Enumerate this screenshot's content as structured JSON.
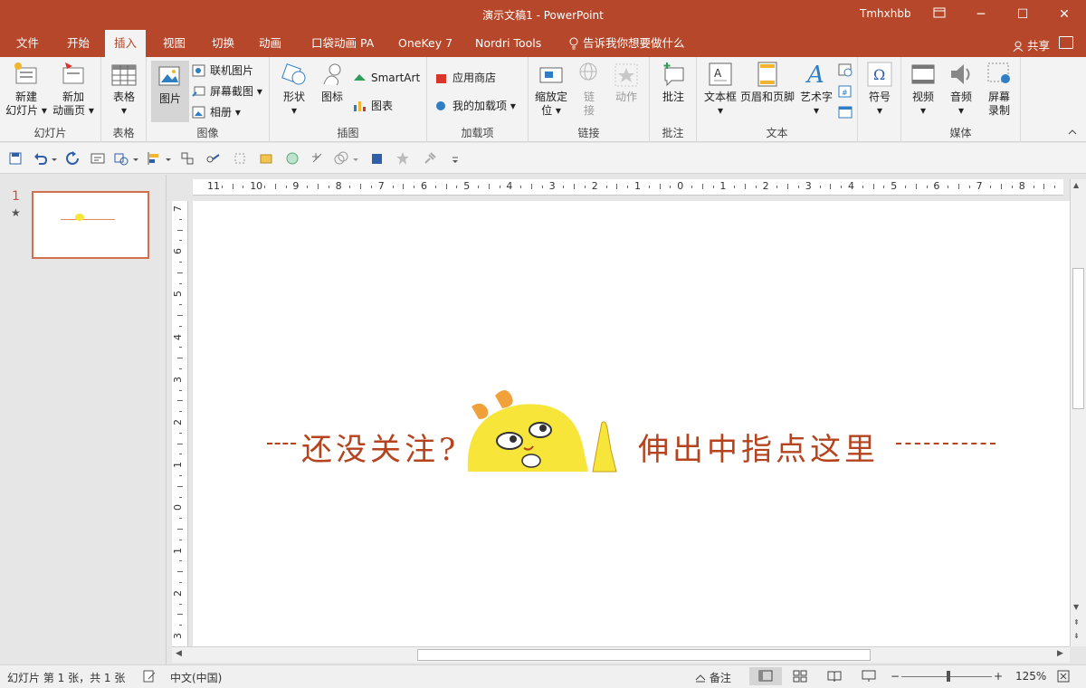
{
  "window": {
    "title": "演示文稿1  -  PowerPoint",
    "user": "Tmhxhbb",
    "controls": {
      "minimize": "─",
      "restore": "☐",
      "close": "✕"
    }
  },
  "tabs": [
    {
      "label": "文件"
    },
    {
      "label": "开始"
    },
    {
      "label": "插入"
    },
    {
      "label": "视图"
    },
    {
      "label": "切换"
    },
    {
      "label": "动画"
    },
    {
      "label": "口袋动画 PA"
    },
    {
      "label": "OneKey 7"
    },
    {
      "label": "Nordri Tools"
    },
    {
      "label": "告诉我你想要做什么"
    }
  ],
  "share": "共享",
  "ribbon": {
    "groups": [
      {
        "label": "幻灯片",
        "buttons": [
          "新建\n幻灯片 ▾",
          "新加\n动画页 ▾"
        ]
      },
      {
        "label": "表格",
        "buttons": [
          "表格\n▾"
        ]
      },
      {
        "label": "图像",
        "big": "图片",
        "small": [
          "联机图片",
          "屏幕截图 ▾",
          "相册  ▾"
        ]
      },
      {
        "label": "插图",
        "buttons": [
          "形状\n▾",
          "图标"
        ],
        "small": [
          "SmartArt",
          "图表"
        ]
      },
      {
        "label": "加载项",
        "small": [
          "应用商店",
          "我的加载项  ▾"
        ]
      },
      {
        "label": "链接",
        "buttons": [
          "缩放定\n位 ▾",
          "链\n接",
          "动作"
        ]
      },
      {
        "label": "批注",
        "buttons": [
          "批注"
        ]
      },
      {
        "label": "文本",
        "buttons": [
          "文本框\n▾",
          "页眉和页脚",
          "艺术字\n▾"
        ]
      },
      {
        "label": "",
        "buttons": [
          "符号\n▾"
        ]
      },
      {
        "label": "媒体",
        "buttons": [
          "视频\n▾",
          "音频\n▾",
          "屏幕\n录制"
        ]
      }
    ]
  },
  "thumbnail": {
    "number": "1",
    "star": "★"
  },
  "ruler": {
    "horizontal": [
      "11",
      "10",
      "9",
      "8",
      "7",
      "6",
      "5",
      "4",
      "3",
      "2",
      "1",
      "0",
      "1",
      "2",
      "3",
      "4",
      "5",
      "6",
      "7",
      "8"
    ],
    "vertical": [
      "7",
      "6",
      "5",
      "4",
      "3",
      "2",
      "1",
      "0",
      "1",
      "2",
      "3"
    ]
  },
  "slide": {
    "left_text": "还没关注?",
    "right_text": "伸出中指点这里"
  },
  "status": {
    "slide_info": "幻灯片 第 1 张，共 1 张",
    "language": "中文(中国)",
    "notes": "备注",
    "zoom": "125%"
  },
  "colors": {
    "accent": "#b7472a",
    "banner_text": "#b4431e",
    "chick": "#f7e53a"
  }
}
